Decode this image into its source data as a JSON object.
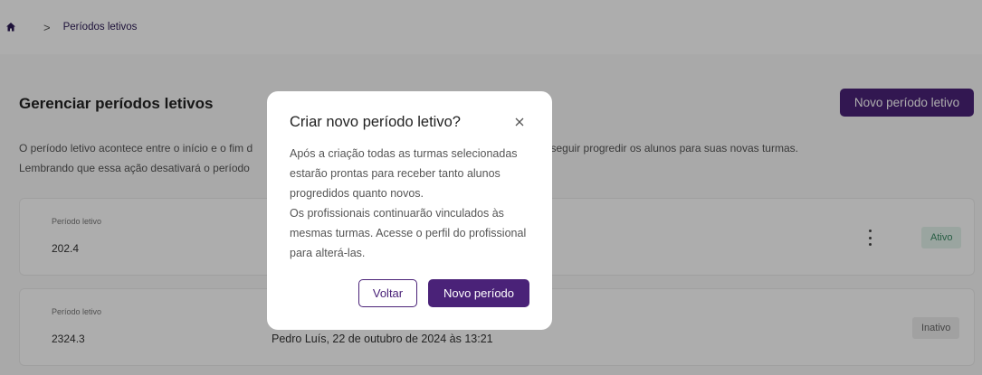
{
  "breadcrumb": {
    "home_icon": "home-icon",
    "separator": ">",
    "current": "Períodos letivos"
  },
  "page": {
    "title": "Gerenciar períodos letivos",
    "new_button": "Novo período letivo",
    "desc_line1": "O período letivo acontece entre o início e o fim d",
    "desc_line1_end": "onseguir progredir os alunos para suas novas turmas.",
    "desc_line2": "Lembrando que essa ação desativará o período"
  },
  "cards": [
    {
      "label": "Período letivo",
      "value": "202.4",
      "meta": "",
      "status": "Ativo",
      "menu_icon": "more-vertical-icon"
    },
    {
      "label": "Período letivo",
      "value": "2324.3",
      "meta": "Pedro Luís, 22 de outubro de 2024 às 13:21",
      "status": "Inativo"
    }
  ],
  "modal": {
    "title": "Criar novo período letivo?",
    "close_icon": "close-icon",
    "paragraph1": "Após a criação todas as turmas selecionadas estarão prontas para receber tanto alunos progredidos quanto novos.",
    "paragraph2": "Os profissionais continuarão vinculados às mesmas turmas. Acesse o perfil do profissional para alterá-las.",
    "back_button": "Voltar",
    "confirm_button": "Novo período"
  },
  "colors": {
    "primary": "#4a2278",
    "active_bg": "#e3f4ec",
    "active_text": "#3a8a64"
  }
}
